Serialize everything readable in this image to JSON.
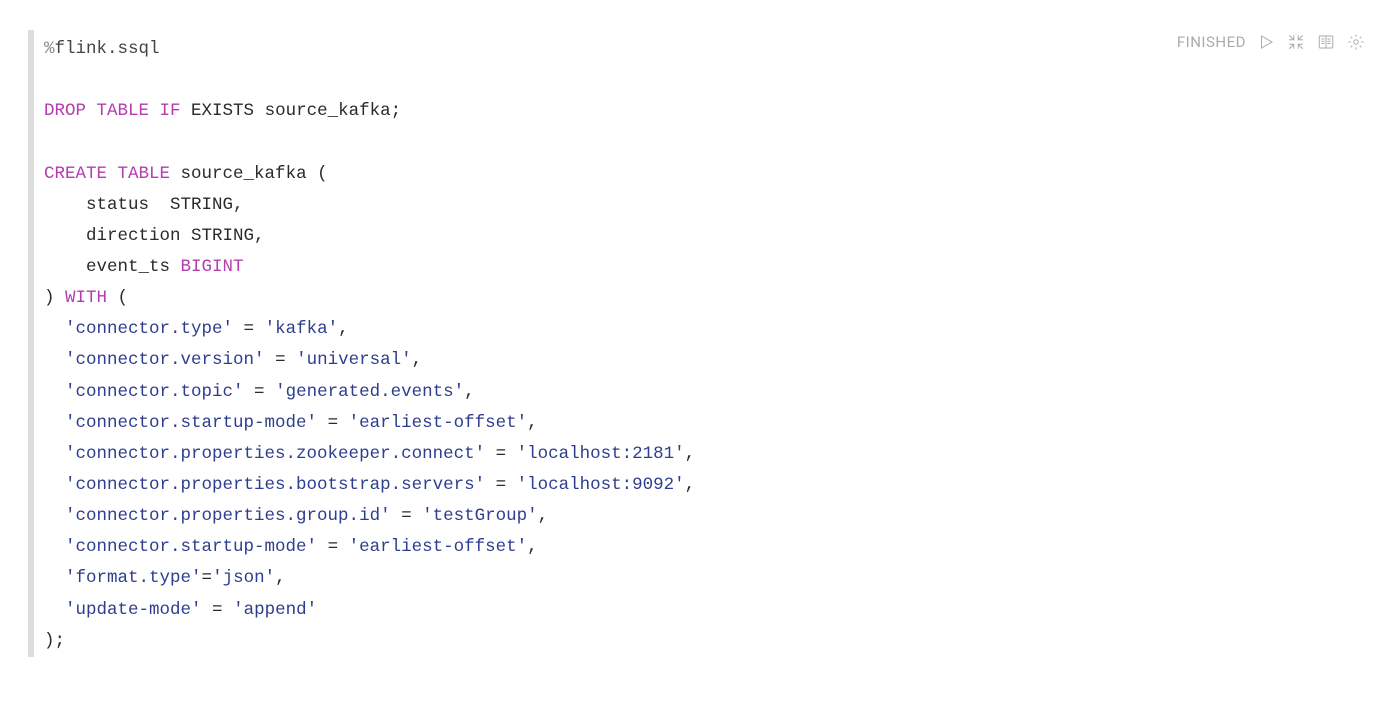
{
  "status": "FINISHED",
  "directive": {
    "percent": "%",
    "name": "flink.ssql"
  },
  "code": {
    "drop": {
      "kw": "DROP TABLE IF",
      "exists": "EXISTS",
      "target": "source_kafka;"
    },
    "create": {
      "kw": "CREATE TABLE",
      "name": "source_kafka ("
    },
    "cols": {
      "c1": {
        "name": "    status  ",
        "type": "STRING,",
        "pad": ""
      },
      "c2": {
        "name": "    direction ",
        "type": "STRING,",
        "pad": ""
      },
      "c3": {
        "name": "    event_ts ",
        "type": "BIGINT",
        "pad": ""
      }
    },
    "with": {
      "close": ") ",
      "kw": "WITH",
      "open": " ("
    },
    "props": [
      {
        "k": "'connector.type'",
        "eq": " = ",
        "v": "'kafka'",
        "t": ","
      },
      {
        "k": "'connector.version'",
        "eq": " = ",
        "v": "'universal'",
        "t": ","
      },
      {
        "k": "'connector.topic'",
        "eq": " = ",
        "v": "'generated.events'",
        "t": ","
      },
      {
        "k": "'connector.startup-mode'",
        "eq": " = ",
        "v": "'earliest-offset'",
        "t": ","
      },
      {
        "k": "'connector.properties.zookeeper.connect'",
        "eq": " = ",
        "v": "'localhost:2181'",
        "t": ","
      },
      {
        "k": "'connector.properties.bootstrap.servers'",
        "eq": " = ",
        "v": "'localhost:9092'",
        "t": ","
      },
      {
        "k": "'connector.properties.group.id'",
        "eq": " = ",
        "v": "'testGroup'",
        "t": ","
      },
      {
        "k": "'connector.startup-mode'",
        "eq": " = ",
        "v": "'earliest-offset'",
        "t": ","
      },
      {
        "k": "'format.type'",
        "eq": "=",
        "v": "'json'",
        "t": ","
      },
      {
        "k": "'update-mode'",
        "eq": " = ",
        "v": "'append'",
        "t": ""
      }
    ],
    "end": ");"
  }
}
